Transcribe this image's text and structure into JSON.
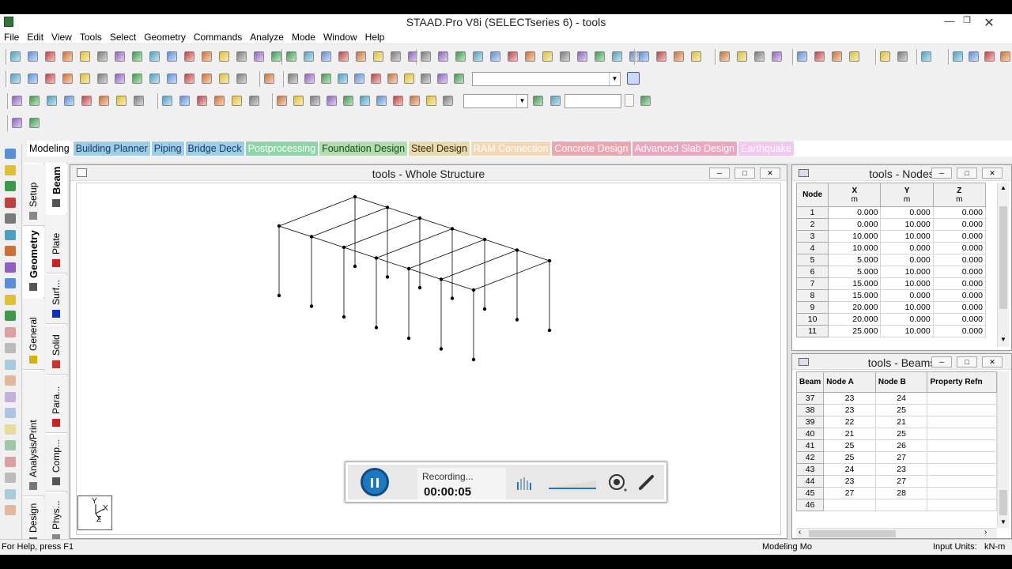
{
  "window": {
    "title": "STAAD.Pro V8i (SELECTseries 6) - tools"
  },
  "menu": [
    "File",
    "Edit",
    "View",
    "Tools",
    "Select",
    "Geometry",
    "Commands",
    "Analyze",
    "Mode",
    "Window",
    "Help"
  ],
  "tabs": [
    {
      "label": "Modeling",
      "color": "#ffffff",
      "text": "#000000"
    },
    {
      "label": "Building Planner",
      "color": "#9fcde6",
      "text": "#1a3a6a"
    },
    {
      "label": "Piping",
      "color": "#9fcde6",
      "text": "#1a3a6a"
    },
    {
      "label": "Bridge Deck",
      "color": "#9fcde6",
      "text": "#1a3a6a"
    },
    {
      "label": "Postprocessing",
      "color": "#8fd3a8",
      "text": "#ffffff"
    },
    {
      "label": "Foundation Design",
      "color": "#b4dcb0",
      "text": "#1a4a1a"
    },
    {
      "label": "Steel Design",
      "color": "#e8d9b0",
      "text": "#3a2a00"
    },
    {
      "label": "RAM Connection",
      "color": "#f4d9b8",
      "text": "#ffffff"
    },
    {
      "label": "Concrete Design",
      "color": "#e9a7b0",
      "text": "#ffffff"
    },
    {
      "label": "Advanced Slab Design",
      "color": "#e9a7c0",
      "text": "#ffffff"
    },
    {
      "label": "Earthquake",
      "color": "#f0c8f0",
      "text": "#ffffff"
    }
  ],
  "vtabs_outer": [
    {
      "label": "Setup",
      "icon": "setup-icon",
      "color": "#888888"
    },
    {
      "label": "Geometry",
      "icon": "geometry-icon",
      "color": "#555555",
      "active": true
    },
    {
      "label": "General",
      "icon": "general-icon",
      "color": "#d8b000"
    },
    {
      "label": "Analysis/Print",
      "icon": "analysis-icon",
      "color": "#777777"
    },
    {
      "label": "Design",
      "icon": "design-icon",
      "color": "#555555"
    }
  ],
  "vtabs_inner": [
    {
      "label": "Beam",
      "icon": "beam-icon",
      "color": "#555555",
      "active": true
    },
    {
      "label": "Plate",
      "icon": "plate-icon",
      "color": "#d02020"
    },
    {
      "label": "Surf...",
      "icon": "surface-icon",
      "color": "#1030c0"
    },
    {
      "label": "Solid",
      "icon": "solid-icon",
      "color": "#d03030"
    },
    {
      "label": "Para...",
      "icon": "parametric-icon",
      "color": "#d02020"
    },
    {
      "label": "Comp...",
      "icon": "composite-icon",
      "color": "#555555"
    },
    {
      "label": "Phys...",
      "icon": "physical-icon",
      "color": "#888888"
    }
  ],
  "viewport": {
    "title": "tools - Whole Structure",
    "axes": {
      "y": "Y",
      "x": "X",
      "z": "Z"
    }
  },
  "nodes_table": {
    "title": "tools - Nodes",
    "headers": {
      "node": "Node",
      "x": "X",
      "y": "Y",
      "z": "Z",
      "unit": "m"
    },
    "rows": [
      [
        "1",
        "0.000",
        "0.000",
        "0.000"
      ],
      [
        "2",
        "0.000",
        "10.000",
        "0.000"
      ],
      [
        "3",
        "10.000",
        "10.000",
        "0.000"
      ],
      [
        "4",
        "10.000",
        "0.000",
        "0.000"
      ],
      [
        "5",
        "5.000",
        "0.000",
        "0.000"
      ],
      [
        "6",
        "5.000",
        "10.000",
        "0.000"
      ],
      [
        "7",
        "15.000",
        "10.000",
        "0.000"
      ],
      [
        "8",
        "15.000",
        "0.000",
        "0.000"
      ],
      [
        "9",
        "20.000",
        "10.000",
        "0.000"
      ],
      [
        "10",
        "20.000",
        "0.000",
        "0.000"
      ],
      [
        "11",
        "25.000",
        "10.000",
        "0.000"
      ]
    ]
  },
  "beams_table": {
    "title": "tools - Beams",
    "headers": {
      "beam": "Beam",
      "a": "Node A",
      "b": "Node B",
      "prop": "Property Refn"
    },
    "rows": [
      [
        "37",
        "23",
        "24"
      ],
      [
        "38",
        "23",
        "25"
      ],
      [
        "39",
        "22",
        "21"
      ],
      [
        "40",
        "21",
        "25"
      ],
      [
        "41",
        "25",
        "26"
      ],
      [
        "42",
        "25",
        "27"
      ],
      [
        "43",
        "24",
        "23"
      ],
      [
        "44",
        "23",
        "27"
      ],
      [
        "45",
        "27",
        "28"
      ],
      [
        "46",
        "",
        ""
      ]
    ]
  },
  "recorder": {
    "status": "Recording...",
    "time": "00:00:05"
  },
  "statusbar": {
    "help": "For Help, press F1",
    "mode": "Modeling Mo",
    "units_label": "Input Units:",
    "units": "kN-m"
  },
  "colors": {
    "accent": "#1d78c2",
    "selected": "#316ac5"
  }
}
